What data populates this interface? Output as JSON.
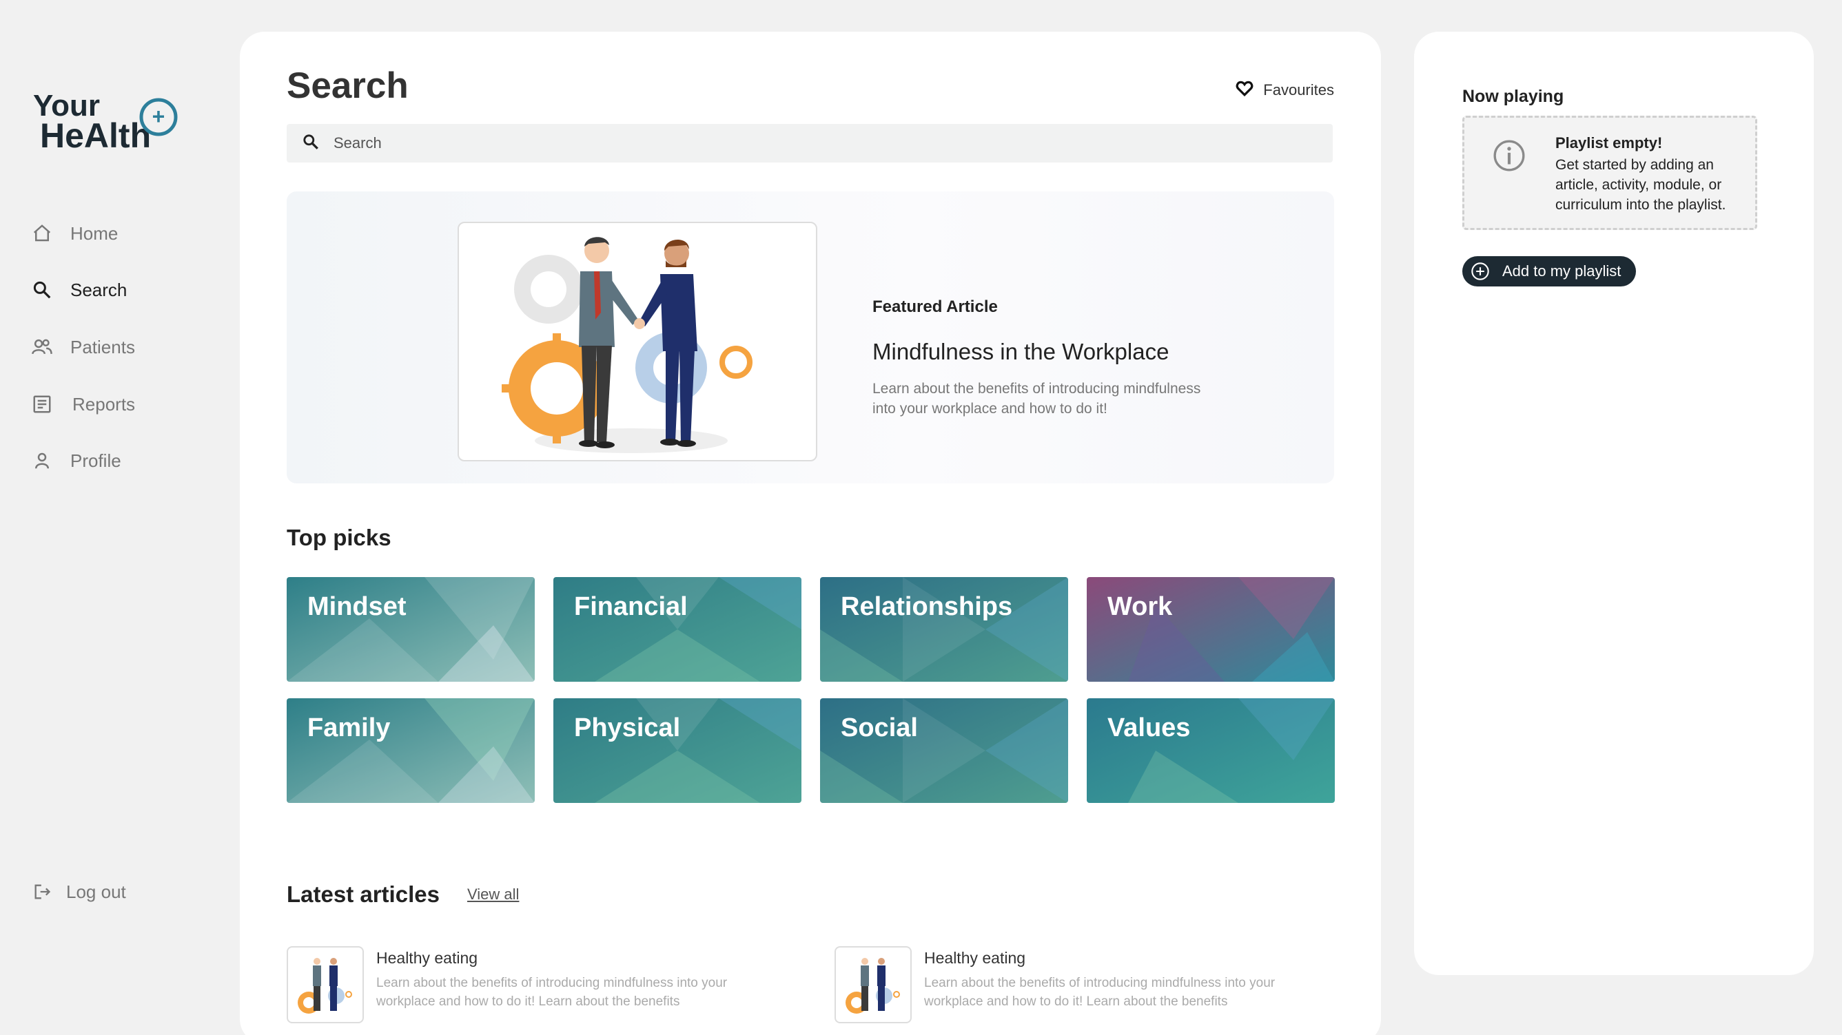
{
  "brand": {
    "line1": "Your",
    "line2": "HeAlth",
    "plus": "+"
  },
  "sidebar": {
    "items": [
      {
        "label": "Home",
        "icon": "home-icon"
      },
      {
        "label": "Search",
        "icon": "search-icon"
      },
      {
        "label": "Patients",
        "icon": "patients-icon"
      },
      {
        "label": "Reports",
        "icon": "reports-icon"
      },
      {
        "label": "Profile",
        "icon": "profile-icon"
      }
    ],
    "active": "Search",
    "logout_label": "Log out"
  },
  "main": {
    "title": "Search",
    "favourites_label": "Favourites",
    "search_placeholder": "Search",
    "featured": {
      "kicker": "Featured Article",
      "title": "Mindfulness in the Workplace",
      "description": "Learn about the benefits of introducing mindfulness into your workplace and how to do it!"
    },
    "top_picks_title": "Top picks",
    "top_picks": [
      "Mindset",
      "Financial",
      "Relationships",
      "Work",
      "Family",
      "Physical",
      "Social",
      "Values"
    ],
    "latest_title": "Latest articles",
    "view_all_label": "View all",
    "articles": [
      {
        "title": "Healthy eating",
        "description": "Learn about the benefits of introducing mindfulness into your workplace and how to do it! Learn about the benefits"
      },
      {
        "title": "Healthy eating",
        "description": "Learn about the benefits of introducing mindfulness into your workplace and how to do it! Learn about the benefits"
      }
    ]
  },
  "panel": {
    "now_playing_title": "Now playing",
    "empty_title": "Playlist empty!",
    "empty_desc": "Get started by adding an article, activity, module, or curriculum into the playlist.",
    "add_button_label": "Add to my playlist"
  },
  "colors": {
    "accent": "#2d7f9b",
    "dark": "#1d2a33",
    "orange": "#f5a340",
    "muted": "#777777"
  }
}
